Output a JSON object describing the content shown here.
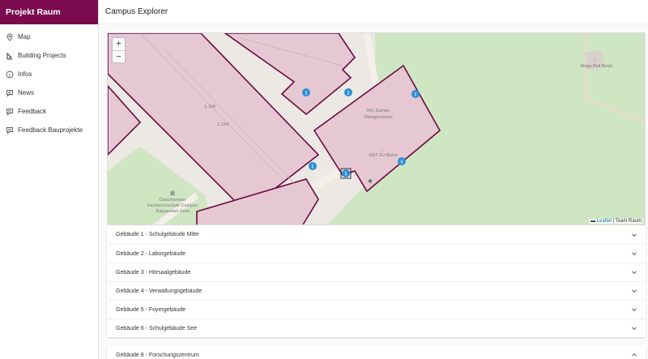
{
  "brand": "Projekt Raum",
  "header": {
    "title": "Campus Explorer"
  },
  "nav": [
    {
      "label": "Map",
      "icon": "map-pin-icon"
    },
    {
      "label": "Building Projects",
      "icon": "crane-icon"
    },
    {
      "label": "Infos",
      "icon": "info-icon"
    },
    {
      "label": "News",
      "icon": "megaphone-icon"
    },
    {
      "label": "Feedback",
      "icon": "feedback-icon"
    },
    {
      "label": "Feedback Bauprojekte",
      "icon": "feedback-icon"
    }
  ],
  "map": {
    "zoom_in": "+",
    "zoom_out": "−",
    "attribution_link": "Leaflet",
    "attribution_text": " | Team Raum",
    "labels": {
      "room_1158": "1.158",
      "room_1154": "1.154",
      "wc_line1": "WC Damen",
      "wc_line2": "Obergeschoss",
      "ost_bistro": "OST RJ Bistro",
      "stopp_line1": "Stopp Bell Beizli",
      "ost_line1": "Ostschweizer",
      "ost_line2": "Fachhochschule Campus",
      "ost_line3": "Rapperswil-Jona"
    }
  },
  "buildings": [
    {
      "label": "Gebäude 1 - Schulgebäude Mitte"
    },
    {
      "label": "Gebäude 2 - Laborgebäude"
    },
    {
      "label": "Gebäude 3 - Hörsaalgebäude"
    },
    {
      "label": "Gebäude 4 - Verwaltungsgebäude"
    },
    {
      "label": "Gebäude 5 - Foyergebäude"
    },
    {
      "label": "Gebäude 6 - Schulgebäude See"
    }
  ],
  "expanded_building": {
    "label": "Gebäude 8 - Forschungszentrum"
  },
  "colors": {
    "brand": "#7b0a4f",
    "building_fill": "#e6c8d2",
    "building_stroke": "#6b0a43",
    "green": "#cfe6c2",
    "marker": "#2a8fd8"
  }
}
